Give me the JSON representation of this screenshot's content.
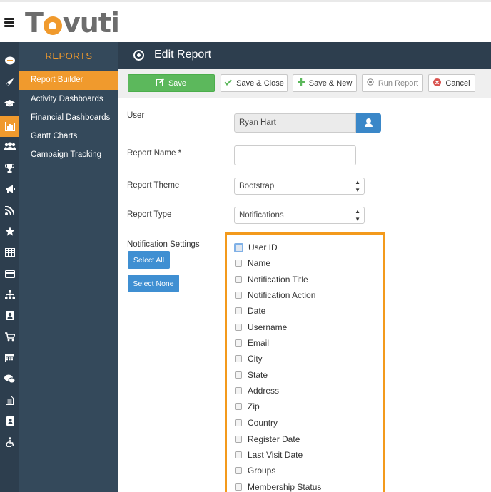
{
  "brand": {
    "logo_text_left": "T",
    "logo_text_right": "vuti"
  },
  "icon_bar": [
    {
      "icon": "chat-bubble-icon"
    },
    {
      "icon": "rocket-icon"
    },
    {
      "icon": "graduation-cap-icon"
    },
    {
      "icon": "bar-chart-icon",
      "active": true
    },
    {
      "icon": "users-icon"
    },
    {
      "icon": "trophy-icon"
    },
    {
      "icon": "megaphone-icon"
    },
    {
      "icon": "feed-icon"
    },
    {
      "icon": "star-icon"
    },
    {
      "icon": "table-icon"
    },
    {
      "icon": "credit-card-icon"
    },
    {
      "icon": "sitemap-icon"
    },
    {
      "icon": "id-badge-icon"
    },
    {
      "icon": "cart-icon"
    },
    {
      "icon": "calendar-icon"
    },
    {
      "icon": "comments-icon"
    },
    {
      "icon": "document-icon"
    },
    {
      "icon": "address-book-icon"
    },
    {
      "icon": "accessibility-icon"
    }
  ],
  "sidebar": {
    "title": "REPORTS",
    "items": [
      {
        "label": "Report Builder",
        "active": true
      },
      {
        "label": "Activity Dashboards"
      },
      {
        "label": "Financial Dashboards"
      },
      {
        "label": "Gantt Charts"
      },
      {
        "label": "Campaign Tracking"
      }
    ]
  },
  "header": {
    "title": "Edit Report"
  },
  "toolbar": {
    "save": "Save",
    "save_close": "Save & Close",
    "save_new": "Save & New",
    "run_report": "Run Report",
    "cancel": "Cancel"
  },
  "form": {
    "user_label": "User",
    "user_value": "Ryan Hart",
    "report_name_label": "Report Name *",
    "report_name_value": "",
    "report_theme_label": "Report Theme",
    "report_theme_value": "Bootstrap",
    "report_type_label": "Report Type",
    "report_type_value": "Notifications",
    "notification_settings_label": "Notification Settings",
    "select_all": "Select All",
    "select_none": "Select None"
  },
  "notification_fields": [
    {
      "label": "User ID",
      "checked": false,
      "focused": true
    },
    {
      "label": "Name",
      "checked": false
    },
    {
      "label": "Notification Title",
      "checked": false
    },
    {
      "label": "Notification Action",
      "checked": false
    },
    {
      "label": "Date",
      "checked": false
    },
    {
      "label": "Username",
      "checked": false
    },
    {
      "label": "Email",
      "checked": false
    },
    {
      "label": "City",
      "checked": false
    },
    {
      "label": "State",
      "checked": false
    },
    {
      "label": "Address",
      "checked": false
    },
    {
      "label": "Zip",
      "checked": false
    },
    {
      "label": "Country",
      "checked": false
    },
    {
      "label": "Register Date",
      "checked": false
    },
    {
      "label": "Last Visit Date",
      "checked": false
    },
    {
      "label": "Groups",
      "checked": false
    },
    {
      "label": "Membership Status",
      "checked": false
    }
  ],
  "colors": {
    "accent": "#f09a2d",
    "sidebar_bg": "#34495b",
    "iconbar_bg": "#2d3e4e",
    "save_green": "#5cb85c",
    "primary_blue": "#3f8fd2",
    "highlight_orange": "#f39a1c"
  }
}
